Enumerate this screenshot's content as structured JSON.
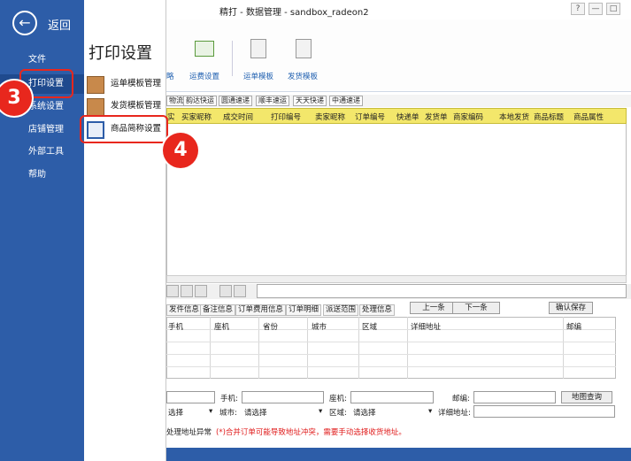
{
  "window": {
    "title": "精打 - 数据管理 - sandbox_radeon2",
    "help": "?",
    "minimize": "—",
    "maximize": "□",
    "close": "✕"
  },
  "left_menu": {
    "back_label": "返回",
    "items": [
      "文件",
      "打印设置",
      "系统设置",
      "店铺管理",
      "外部工具",
      "帮助"
    ],
    "active_color": "#1f4a8e"
  },
  "submenu": {
    "title": "打印设置",
    "items": [
      "运单模板管理",
      "发货模板管理",
      "商品简称设置"
    ]
  },
  "ribbon": {
    "labels": [
      "略",
      "运费设置",
      "运单模板",
      "发货模板"
    ]
  },
  "carrier_tabs": [
    "物流",
    "韵达快运",
    "圆通速递",
    "顺丰速运",
    "天天快递",
    "中通速递"
  ],
  "grid": {
    "columns": [
      "实",
      "买家昵称",
      "成交时间",
      "打印编号",
      "卖家昵称",
      "订单编号",
      "快递单",
      "发货单",
      "商家编码",
      "本地发货",
      "商品标题",
      "商品属性"
    ]
  },
  "bottom_tabs": [
    "发件信息",
    "备注信息",
    "订单费用信息",
    "订单明细",
    "派送范围",
    "处理信息"
  ],
  "buttons": {
    "prev": "上一条",
    "next": "下一条",
    "confirm": "确认保存",
    "map": "地图查询"
  },
  "address_grid": {
    "columns": [
      "手机",
      "座机",
      "省份",
      "城市",
      "区域",
      "详细地址",
      "邮编"
    ]
  },
  "form": {
    "phone_label": "手机:",
    "landline_label": "座机:",
    "zip_label": "邮编:",
    "select_placeholder": "选择",
    "city_label": "城市:",
    "city_placeholder": "请选择",
    "district_label": "区域:",
    "district_placeholder": "请选择",
    "detail_label": "详细地址:"
  },
  "notes": {
    "abnormal": "处理地址异常",
    "warning": "(*)合并订单可能导致地址冲突，需要手动选择收货地址。"
  },
  "markers": [
    "3",
    "4"
  ]
}
